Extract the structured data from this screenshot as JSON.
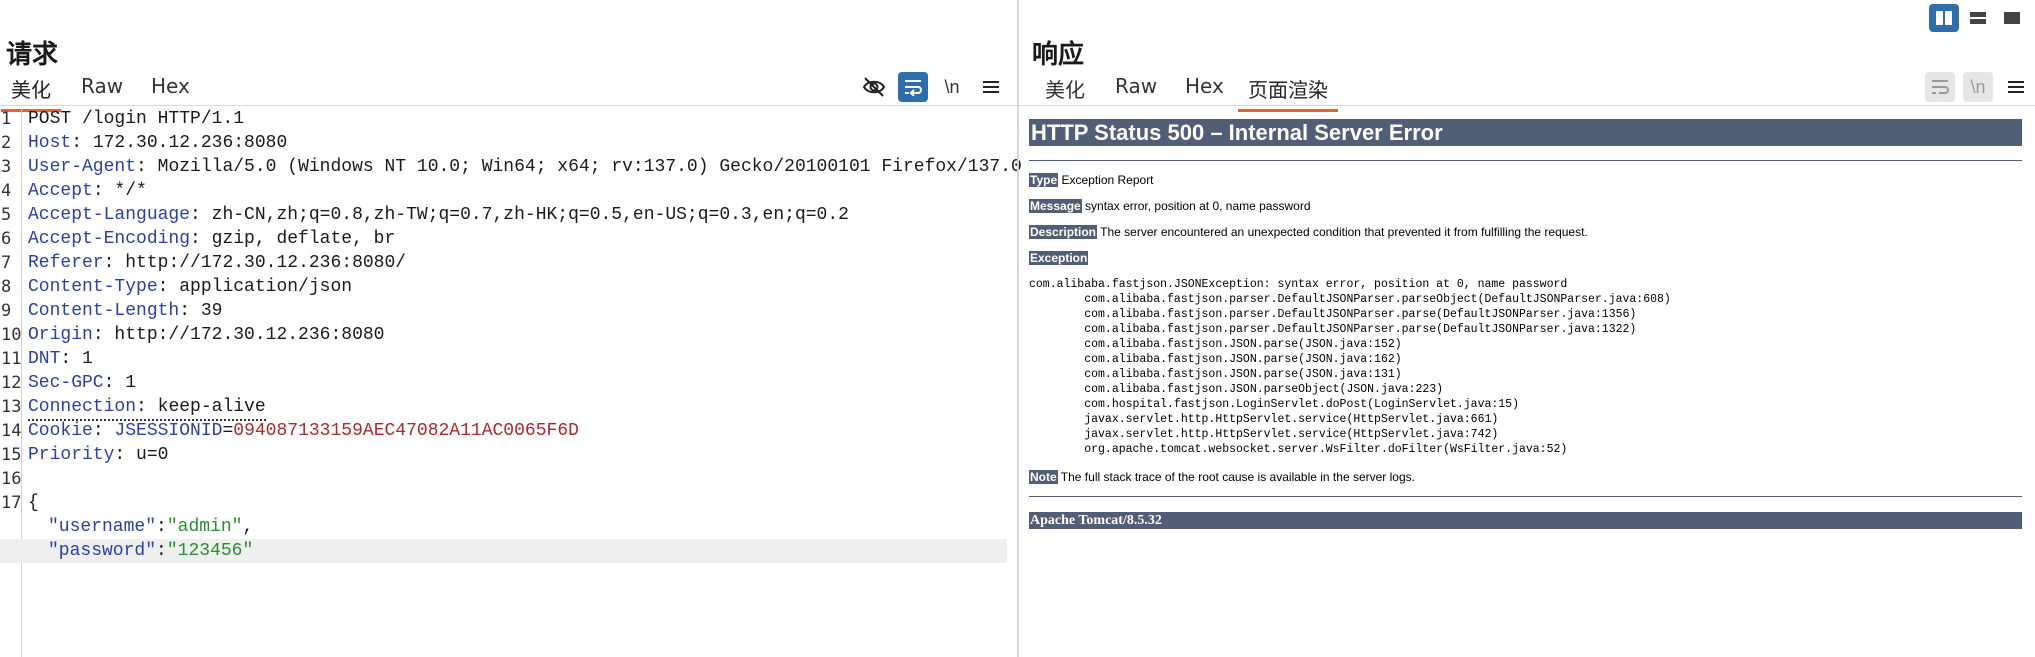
{
  "request": {
    "title": "请求",
    "tabs": [
      "美化",
      "Raw",
      "Hex"
    ],
    "active_tab": "美化",
    "tools": {
      "hide_icon": "eye-slash-icon",
      "wrap_icon": "wrap-icon",
      "newline_label": "\\n",
      "menu_icon": "menu-icon"
    },
    "line_numbers": [
      "1",
      "2",
      "3",
      "4",
      "5",
      "6",
      "7",
      "8",
      "9",
      "10",
      "11",
      "12",
      "13",
      "14",
      "15",
      "16",
      "17"
    ],
    "request_line": "POST /login HTTP/1.1",
    "headers": [
      {
        "name": "Host",
        "value": " 172.30.12.236:8080"
      },
      {
        "name": "User-Agent",
        "value": " Mozilla/5.0 (Windows NT 10.0; Win64; x64; rv:137.0) Gecko/20100101 Firefox/137.0"
      },
      {
        "name": "Accept",
        "value": " */*"
      },
      {
        "name": "Accept-Language",
        "value": " zh-CN,zh;q=0.8,zh-TW;q=0.7,zh-HK;q=0.5,en-US;q=0.3,en;q=0.2"
      },
      {
        "name": "Accept-Encoding",
        "value": " gzip, deflate, br"
      },
      {
        "name": "Referer",
        "value": " http://172.30.12.236:8080/"
      },
      {
        "name": "Content-Type",
        "value": " application/json"
      },
      {
        "name": "Content-Length",
        "value": " 39"
      },
      {
        "name": "Origin",
        "value": " http://172.30.12.236:8080"
      },
      {
        "name": "DNT",
        "value": " 1"
      },
      {
        "name": "Sec-GPC",
        "value": " 1"
      },
      {
        "name": "Connection",
        "value": " keep-alive"
      }
    ],
    "cookie": {
      "label": "Cookie",
      "name": "JSESSIONID",
      "value": "094087133159AEC47082A11AC0065F6D"
    },
    "priority": {
      "name": "Priority",
      "value": " u=0"
    },
    "body": {
      "open": "{",
      "username_key": "\"username\"",
      "username_val": "\"admin\"",
      "password_key": "\"password\"",
      "password_val": "\"123456\"",
      "colon": ":",
      "comma": ","
    }
  },
  "response": {
    "title": "响应",
    "tabs": [
      "美化",
      "Raw",
      "Hex",
      "页面渲染"
    ],
    "active_tab": "页面渲染",
    "tools": {
      "wrap_icon": "wrap-icon",
      "newline_label": "\\n",
      "menu_icon": "menu-icon"
    },
    "page": {
      "heading": "HTTP Status 500 – Internal Server Error",
      "type_label": "Type",
      "type_value": "Exception Report",
      "message_label": "Message",
      "message_value": "syntax error, position at 0, name password",
      "description_label": "Description",
      "description_value": "The server encountered an unexpected condition that prevented it from fulfilling the request.",
      "exception_label": "Exception",
      "stack": [
        "com.alibaba.fastjson.JSONException: syntax error, position at 0, name password",
        "\tcom.alibaba.fastjson.parser.DefaultJSONParser.parseObject(DefaultJSONParser.java:608)",
        "\tcom.alibaba.fastjson.parser.DefaultJSONParser.parse(DefaultJSONParser.java:1356)",
        "\tcom.alibaba.fastjson.parser.DefaultJSONParser.parse(DefaultJSONParser.java:1322)",
        "\tcom.alibaba.fastjson.JSON.parse(JSON.java:152)",
        "\tcom.alibaba.fastjson.JSON.parse(JSON.java:162)",
        "\tcom.alibaba.fastjson.JSON.parse(JSON.java:131)",
        "\tcom.alibaba.fastjson.JSON.parseObject(JSON.java:223)",
        "\tcom.hospital.fastjson.LoginServlet.doPost(LoginServlet.java:15)",
        "\tjavax.servlet.http.HttpServlet.service(HttpServlet.java:661)",
        "\tjavax.servlet.http.HttpServlet.service(HttpServlet.java:742)",
        "\torg.apache.tomcat.websocket.server.WsFilter.doFilter(WsFilter.java:52)"
      ],
      "note_label": "Note",
      "note_value": "The full stack trace of the root cause is available in the server logs.",
      "footer": "Apache Tomcat/8.5.32"
    }
  },
  "layout_toggles": [
    "split-columns-icon",
    "split-rows-icon",
    "single-pane-icon"
  ],
  "colors": {
    "accent": "#e8632b",
    "tool_on": "#2f6ea8",
    "tomcat_bar": "#525d76"
  }
}
